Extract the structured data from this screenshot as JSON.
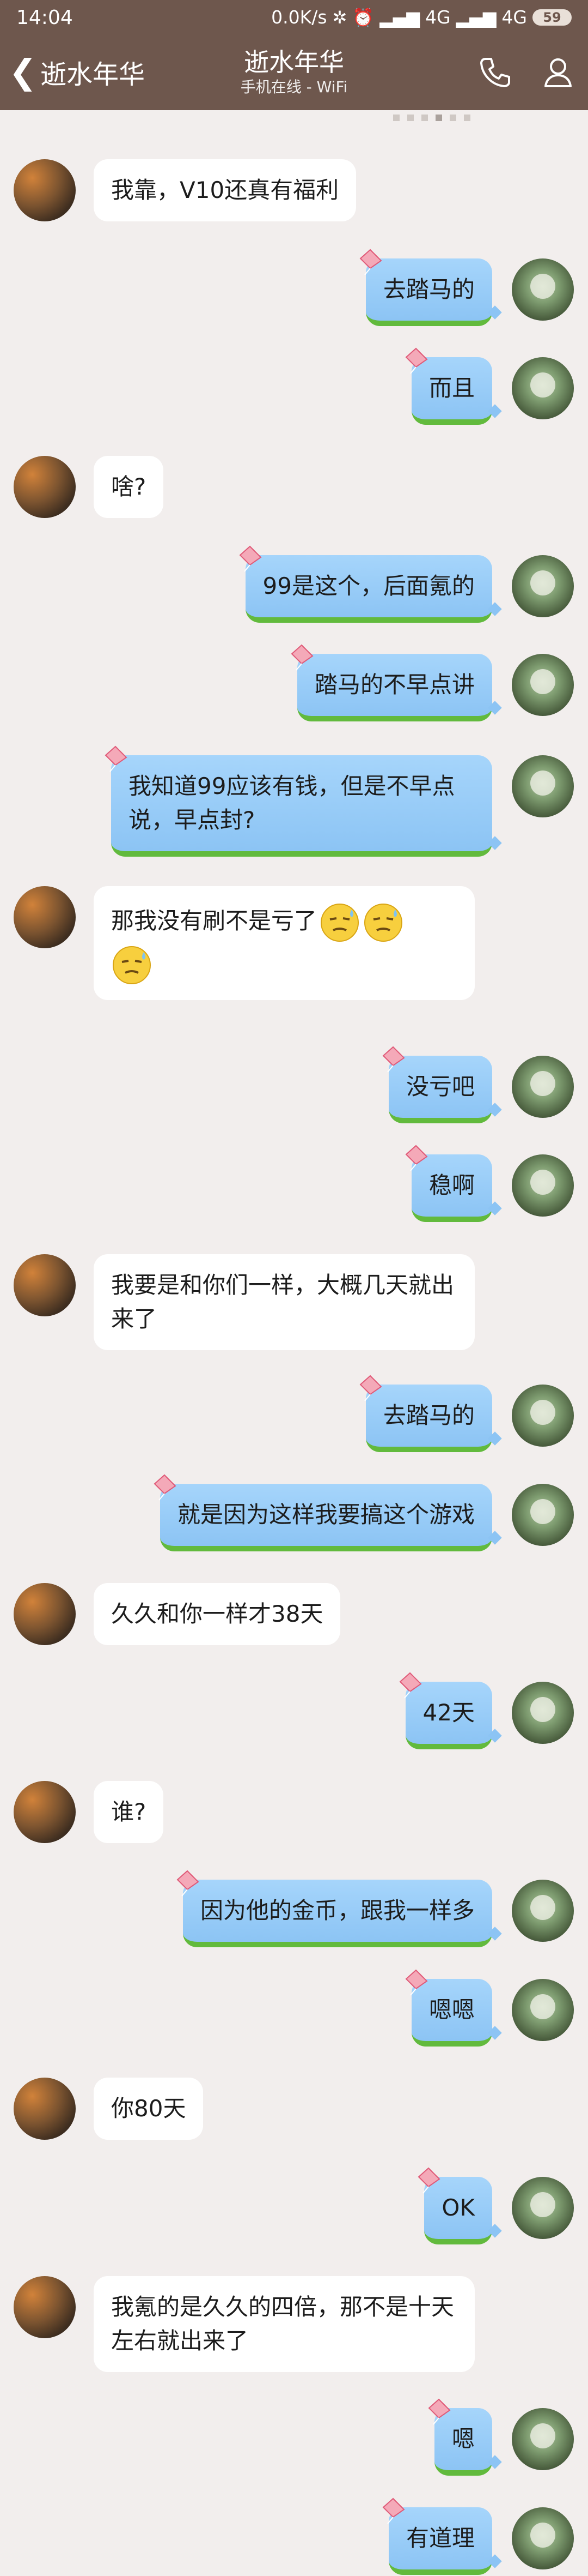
{
  "status": {
    "time": "14:04",
    "speed": "0.0K/s",
    "net1": "4G",
    "net2": "4G",
    "battery": "59"
  },
  "header": {
    "back_label": "逝水年华",
    "title": "逝水年华",
    "subtitle": "手机在线 - WiFi"
  },
  "messages": [
    {
      "side": "left",
      "text": "我靠，V10还真有福利"
    },
    {
      "side": "right",
      "text": "去踏马的"
    },
    {
      "side": "right",
      "text": "而且"
    },
    {
      "side": "left",
      "text": "啥?"
    },
    {
      "side": "right",
      "text": "99是这个，后面氪的"
    },
    {
      "side": "right",
      "text": "踏马的不早点讲"
    },
    {
      "side": "right",
      "text": "我知道99应该有钱，但是不早点说，早点封?"
    },
    {
      "side": "left",
      "text": "那我没有刷不是亏了"
    },
    {
      "side": "right",
      "text": "没亏吧"
    },
    {
      "side": "right",
      "text": "稳啊"
    },
    {
      "side": "left",
      "text": "我要是和你们一样，大概几天就出来了"
    },
    {
      "side": "right",
      "text": "去踏马的"
    },
    {
      "side": "right",
      "text": "就是因为这样我要搞这个游戏"
    },
    {
      "side": "left",
      "text": "久久和你一样才38天"
    },
    {
      "side": "right",
      "text": "42天"
    },
    {
      "side": "left",
      "text": "谁?"
    },
    {
      "side": "right",
      "text": "因为他的金币，跟我一样多"
    },
    {
      "side": "right",
      "text": "嗯嗯"
    },
    {
      "side": "left",
      "text": "你80天"
    },
    {
      "side": "right",
      "text": "OK"
    },
    {
      "side": "left",
      "text": "我氪的是久久的四倍，那不是十天左右就出来了"
    },
    {
      "side": "right",
      "text": "嗯"
    },
    {
      "side": "right",
      "text": "有道理"
    }
  ],
  "icons": {
    "phone": "phone-icon",
    "profile": "profile-icon",
    "back": "chevron-left-icon",
    "kite": "kite-icon",
    "emoji": "sweat-emoji-icon"
  }
}
